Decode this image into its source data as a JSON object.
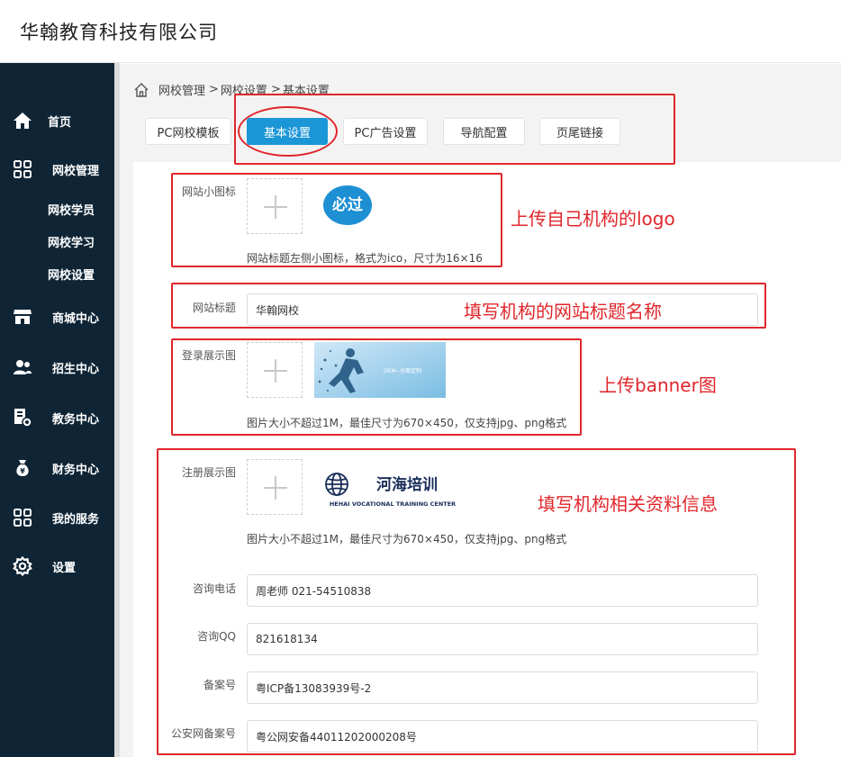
{
  "header": {
    "company": "华翰教育科技有限公司"
  },
  "sidebar": {
    "items": [
      {
        "label": "首页",
        "icon": "home-icon"
      },
      {
        "label": "网校管理",
        "icon": "grid-icon"
      },
      {
        "label": "商城中心",
        "icon": "store-icon"
      },
      {
        "label": "招生中心",
        "icon": "users-icon"
      },
      {
        "label": "教务中心",
        "icon": "academic-icon"
      },
      {
        "label": "财务中心",
        "icon": "money-bag-icon"
      },
      {
        "label": "我的服务",
        "icon": "grid-icon"
      },
      {
        "label": "设置",
        "icon": "gear-icon"
      }
    ],
    "subitems": [
      "网校学员",
      "网校学习",
      "网校设置"
    ]
  },
  "breadcrumb": {
    "part1": "网校管理",
    "part2": "网校设置",
    "part3": "基本设置"
  },
  "tabs": [
    "PC网校模板",
    "基本设置",
    "PC广告设置",
    "导航配置",
    "页尾链接"
  ],
  "form": {
    "favicon": {
      "label": "网站小图标",
      "hint": "网站标题左侧小图标，格式为ico，尺寸为16×16",
      "logo_text": "必过"
    },
    "site_title": {
      "label": "网站标题",
      "value": "华翰网校"
    },
    "login_image": {
      "label": "登录展示图",
      "hint": "图片大小不超过1M，最佳尺寸为670×450，仅支持jpg、png格式",
      "banner_text": "OEM--全面定制"
    },
    "register_image": {
      "label": "注册展示图",
      "hint": "图片大小不超过1M，最佳尺寸为670×450，仅支持jpg、png格式",
      "logo_cn": "河海培训",
      "logo_en": "HEHAI VOCATIONAL TRAINING CENTER"
    },
    "phone": {
      "label": "咨询电话",
      "value": "周老师 021-54510838"
    },
    "qq": {
      "label": "咨询QQ",
      "value": "821618134"
    },
    "icp": {
      "label": "备案号",
      "value": "粤ICP备13083939号-2"
    },
    "police": {
      "label": "公安网备案号",
      "value": "粤公网安备44011202000208号"
    }
  },
  "annotations": {
    "logo": "上传自己机构的logo",
    "title": "填写机构的网站标题名称",
    "banner": "上传banner图",
    "info": "填写机构相关资料信息"
  },
  "colors": {
    "sidebar": "#0f2536",
    "accent": "#1b96d6",
    "annotation": "#e0262b"
  }
}
